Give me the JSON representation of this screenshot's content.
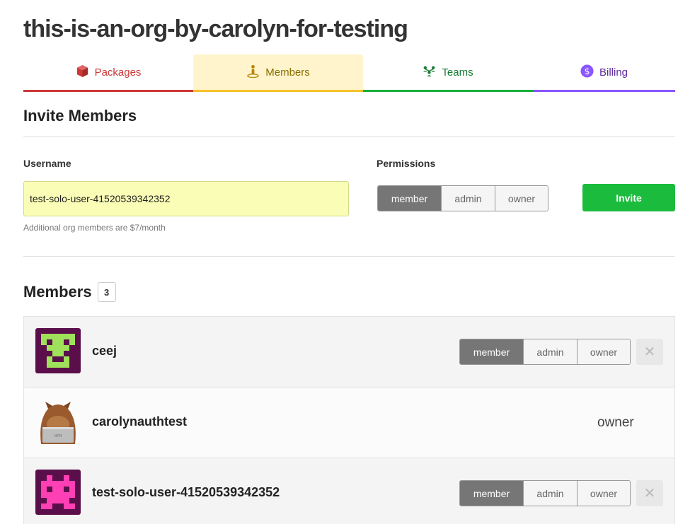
{
  "org": {
    "title": "this-is-an-org-by-carolyn-for-testing"
  },
  "tabs": [
    {
      "label": "Packages",
      "icon": "package-icon",
      "color": "#cb3837"
    },
    {
      "label": "Members",
      "icon": "person-icon",
      "color": "#8a6d00",
      "active": true
    },
    {
      "label": "Teams",
      "icon": "teams-icon",
      "color": "#157a33"
    },
    {
      "label": "Billing",
      "icon": "dollar-icon",
      "color": "#5b2a9b"
    }
  ],
  "invite": {
    "title": "Invite Members",
    "username_label": "Username",
    "username_value": "test-solo-user-41520539342352",
    "hint": "Additional org members are $7/month",
    "permissions_label": "Permissions",
    "permissions": [
      "member",
      "admin",
      "owner"
    ],
    "selected_permission": "member",
    "invite_button": "Invite"
  },
  "members": {
    "title": "Members",
    "count": "3",
    "rows": [
      {
        "name": "ceej",
        "role": "member",
        "avatar": "green-pixel-avatar",
        "editable": true
      },
      {
        "name": "carolynauthtest",
        "role": "owner",
        "avatar": "wombat-avatar",
        "editable": false
      },
      {
        "name": "test-solo-user-41520539342352",
        "role": "member",
        "avatar": "pink-pixel-avatar",
        "editable": true
      }
    ],
    "role_options": [
      "member",
      "admin",
      "owner"
    ],
    "remove_symbol": "✕"
  }
}
